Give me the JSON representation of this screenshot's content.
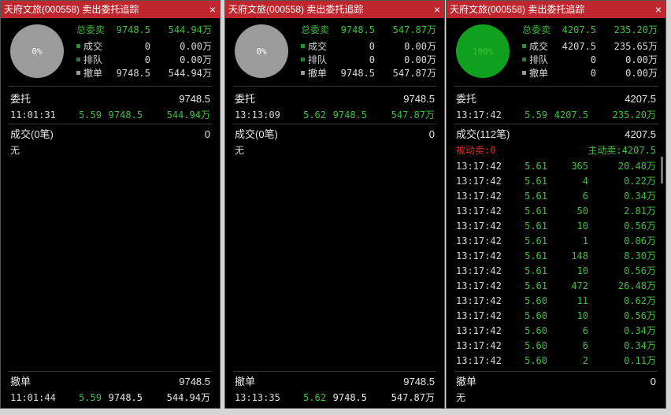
{
  "panels": [
    {
      "title": "天府文旅(000558) 卖出委托追踪",
      "pie": {
        "label": "0%",
        "color": "#9b9b9b"
      },
      "summary": {
        "total": {
          "label": "总委卖",
          "vol": "9748.5",
          "amt": "544.94万"
        },
        "deal": {
          "label": "成交",
          "vol": "0",
          "amt": "0.00万"
        },
        "queue": {
          "label": "排队",
          "vol": "0",
          "amt": "0.00万"
        },
        "cancel": {
          "label": "撤单",
          "vol": "9748.5",
          "amt": "544.94万"
        }
      },
      "order": {
        "label": "委托",
        "total": "9748.5",
        "time": "11:01:31",
        "price": "5.59",
        "vol": "9748.5",
        "amt": "544.94万"
      },
      "trades": {
        "label": "成交(0笔)",
        "count": "0",
        "none": "无"
      },
      "cancel": {
        "label": "撤单",
        "total": "9748.5",
        "time": "11:01:44",
        "price": "5.59",
        "vol": "9748.5",
        "amt": "544.94万"
      }
    },
    {
      "title": "天府文旅(000558) 卖出委托追踪",
      "pie": {
        "label": "0%",
        "color": "#9b9b9b"
      },
      "summary": {
        "total": {
          "label": "总委卖",
          "vol": "9748.5",
          "amt": "547.87万"
        },
        "deal": {
          "label": "成交",
          "vol": "0",
          "amt": "0.00万"
        },
        "queue": {
          "label": "排队",
          "vol": "0",
          "amt": "0.00万"
        },
        "cancel": {
          "label": "撤单",
          "vol": "9748.5",
          "amt": "547.87万"
        }
      },
      "order": {
        "label": "委托",
        "total": "9748.5",
        "time": "13:13:09",
        "price": "5.62",
        "vol": "9748.5",
        "amt": "547.87万"
      },
      "trades": {
        "label": "成交(0笔)",
        "count": "0",
        "none": "无"
      },
      "cancel": {
        "label": "撤单",
        "total": "9748.5",
        "time": "13:13:35",
        "price": "5.62",
        "vol": "9748.5",
        "amt": "547.87万"
      }
    },
    {
      "title": "天府文旅(000558) 卖出委托追踪",
      "pie": {
        "label": "100%",
        "color": "#0fa01e"
      },
      "summary": {
        "total": {
          "label": "总委卖",
          "vol": "4207.5",
          "amt": "235.20万"
        },
        "deal": {
          "label": "成交",
          "vol": "4207.5",
          "amt": "235.65万"
        },
        "queue": {
          "label": "排队",
          "vol": "0",
          "amt": "0.00万"
        },
        "cancel": {
          "label": "撤单",
          "vol": "0",
          "amt": "0.00万"
        }
      },
      "order": {
        "label": "委托",
        "total": "4207.5",
        "time": "13:17:42",
        "price": "5.59",
        "vol": "4207.5",
        "amt": "235.20万"
      },
      "trades": {
        "label": "成交(112笔)",
        "count": "4207.5",
        "passive": "被动卖:0",
        "active": "主动卖:4207.5"
      },
      "cancel": {
        "label": "撤单",
        "total": "0",
        "none": "无"
      },
      "trade_rows": [
        {
          "time": "13:17:42",
          "price": "5.61",
          "vol": "365",
          "amt": "20.48万"
        },
        {
          "time": "13:17:42",
          "price": "5.61",
          "vol": "4",
          "amt": "0.22万"
        },
        {
          "time": "13:17:42",
          "price": "5.61",
          "vol": "6",
          "amt": "0.34万"
        },
        {
          "time": "13:17:42",
          "price": "5.61",
          "vol": "50",
          "amt": "2.81万"
        },
        {
          "time": "13:17:42",
          "price": "5.61",
          "vol": "10",
          "amt": "0.56万"
        },
        {
          "time": "13:17:42",
          "price": "5.61",
          "vol": "1",
          "amt": "0.06万"
        },
        {
          "time": "13:17:42",
          "price": "5.61",
          "vol": "148",
          "amt": "8.30万"
        },
        {
          "time": "13:17:42",
          "price": "5.61",
          "vol": "10",
          "amt": "0.56万"
        },
        {
          "time": "13:17:42",
          "price": "5.61",
          "vol": "472",
          "amt": "26.48万"
        },
        {
          "time": "13:17:42",
          "price": "5.60",
          "vol": "11",
          "amt": "0.62万"
        },
        {
          "time": "13:17:42",
          "price": "5.60",
          "vol": "10",
          "amt": "0.56万"
        },
        {
          "time": "13:17:42",
          "price": "5.60",
          "vol": "6",
          "amt": "0.34万"
        },
        {
          "time": "13:17:42",
          "price": "5.60",
          "vol": "6",
          "amt": "0.34万"
        },
        {
          "time": "13:17:42",
          "price": "5.60",
          "vol": "2",
          "amt": "0.11万"
        }
      ]
    }
  ],
  "icons": {
    "close": "×"
  }
}
